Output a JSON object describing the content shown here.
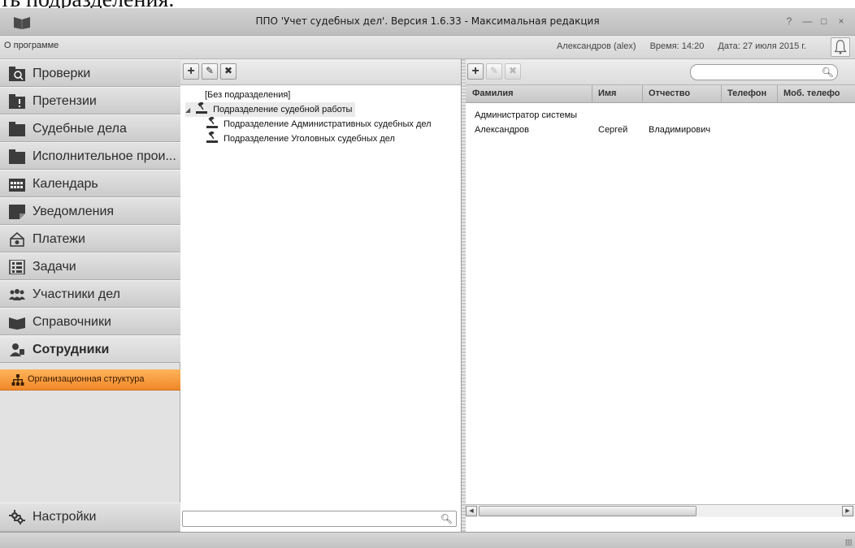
{
  "clipped_header_text": "ть подразделения.",
  "window": {
    "title": "ППО 'Учет судебных дел'. Версия 1.6.33 - Максимальная редакция",
    "controls": [
      "?",
      "—",
      "□",
      "×"
    ]
  },
  "menubar": {
    "about": "О программе",
    "user": "Александров (alex)",
    "time": "Время: 14:20",
    "date": "Дата: 27 июля 2015 г."
  },
  "sidebar": {
    "items": [
      {
        "label": "Проверки",
        "icon": "folder-search-icon"
      },
      {
        "label": "Претензии",
        "icon": "folder-alert-icon"
      },
      {
        "label": "Судебные дела",
        "icon": "folder-icon"
      },
      {
        "label": "Исполнительное прои...",
        "icon": "folder-icon"
      },
      {
        "label": "Календарь",
        "icon": "calendar-icon"
      },
      {
        "label": "Уведомления",
        "icon": "notification-icon"
      },
      {
        "label": "Платежи",
        "icon": "payment-icon"
      },
      {
        "label": "Задачи",
        "icon": "tasks-icon"
      },
      {
        "label": "Участники дел",
        "icon": "participants-icon"
      },
      {
        "label": "Справочники",
        "icon": "book-icon"
      },
      {
        "label": "Сотрудники",
        "icon": "employee-icon"
      }
    ],
    "active_sub": {
      "label": "Организационная структура",
      "icon": "org-structure-icon"
    },
    "settings": {
      "label": "Настройки",
      "icon": "gears-icon"
    }
  },
  "tree": {
    "toolbar": {
      "add": "+",
      "edit": "✎",
      "delete": "✖"
    },
    "rows": [
      {
        "label": "[Без подразделения]",
        "level": 0
      },
      {
        "label": "Подразделение судебной работы",
        "level": 0
      },
      {
        "label": "Подразделение Административных судебных дел",
        "level": 1
      },
      {
        "label": "Подразделение Уголовных судебных дел",
        "level": 1
      }
    ]
  },
  "staff": {
    "toolbar": {
      "add": "+",
      "edit": "✎",
      "delete": "✖"
    },
    "columns": [
      "Фамилия",
      "Имя",
      "Отчество",
      "Телефон",
      "Моб. телефо"
    ],
    "rows": [
      [
        "Администратор системы",
        "",
        "",
        "",
        ""
      ],
      [
        "Александров",
        "Сергей",
        "Владимирович",
        "",
        ""
      ]
    ]
  },
  "colors": {
    "accent": "#f0882a",
    "sidebar_bg": "#e2e2e2",
    "title_bg": "#c8c8c8"
  }
}
